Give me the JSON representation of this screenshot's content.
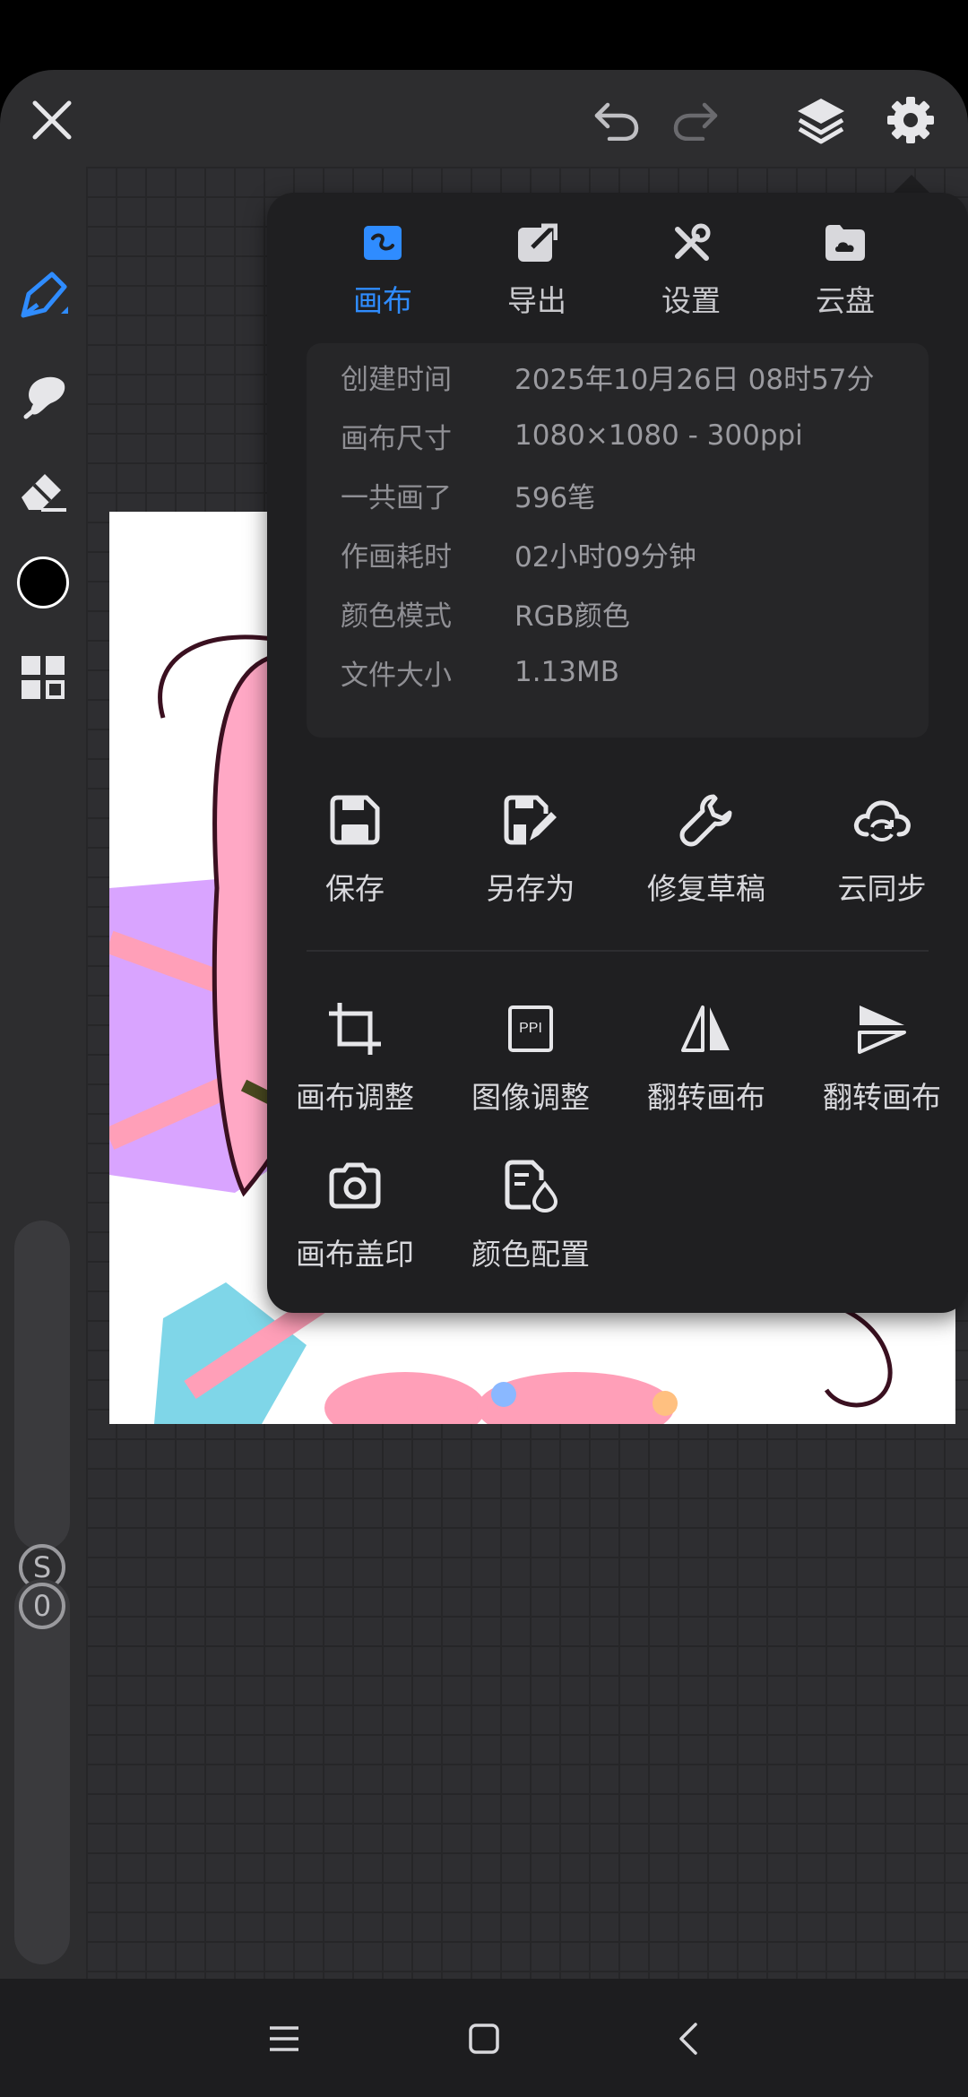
{
  "colors": {
    "accent": "#2f8cff",
    "panel_bg": "#1f1f21",
    "app_bg": "#2d2d2f",
    "current_color": "#000000"
  },
  "topbar": {
    "icons": [
      "close-icon",
      "undo-icon",
      "redo-icon",
      "layers-icon",
      "settings-icon"
    ]
  },
  "sidebar": {
    "tools": [
      "pen-icon",
      "smudge-icon",
      "eraser-icon",
      "color-swatch",
      "grid-tools-icon"
    ],
    "size_slider_label": "S",
    "opacity_slider_label": "0"
  },
  "panel": {
    "tabs": [
      {
        "label": "画布",
        "icon": "canvas-icon",
        "active": true
      },
      {
        "label": "导出",
        "icon": "export-icon",
        "active": false
      },
      {
        "label": "设置",
        "icon": "tools-icon",
        "active": false
      },
      {
        "label": "云盘",
        "icon": "cloud-folder-icon",
        "active": false
      }
    ],
    "info": [
      {
        "key": "创建时间",
        "value": "2025年10月26日 08时57分"
      },
      {
        "key": "画布尺寸",
        "value": "1080×1080 - 300ppi"
      },
      {
        "key": "一共画了",
        "value": "596笔"
      },
      {
        "key": "作画耗时",
        "value": "02小时09分钟"
      },
      {
        "key": "颜色模式",
        "value": "RGB颜色"
      },
      {
        "key": "文件大小",
        "value": "1.13MB"
      }
    ],
    "actions_row1": [
      {
        "label": "保存",
        "icon": "save-icon"
      },
      {
        "label": "另存为",
        "icon": "save-as-icon"
      },
      {
        "label": "修复草稿",
        "icon": "wrench-icon"
      },
      {
        "label": "云同步",
        "icon": "cloud-sync-icon"
      }
    ],
    "actions_row2": [
      {
        "label": "画布调整",
        "icon": "crop-icon"
      },
      {
        "label": "图像调整",
        "icon": "ppi-icon",
        "icon_text": "PPI"
      },
      {
        "label": "翻转画布",
        "icon": "flip-horizontal-icon"
      },
      {
        "label": "翻转画布",
        "icon": "flip-vertical-icon"
      }
    ],
    "actions_row3": [
      {
        "label": "画布盖印",
        "icon": "camera-icon"
      },
      {
        "label": "颜色配置",
        "icon": "color-profile-icon"
      }
    ]
  },
  "navbar": {
    "icons": [
      "menu-icon",
      "home-icon",
      "back-icon"
    ]
  }
}
